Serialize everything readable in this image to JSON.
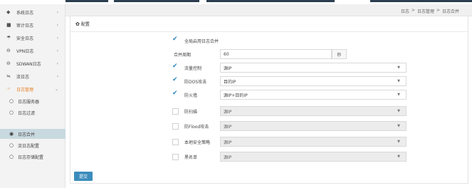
{
  "breadcrumb": [
    "日志",
    ">",
    "日志管理",
    ">",
    "日志合并"
  ],
  "sidebar": {
    "items": [
      {
        "icon": "tag-icon",
        "glyph": "◆",
        "label": "系统日志",
        "chevron": "‹"
      },
      {
        "icon": "monitor-icon",
        "glyph": "■",
        "label": "审计日志",
        "chevron": "‹"
      },
      {
        "icon": "umbrella-icon",
        "glyph": "☂",
        "label": "安全日志",
        "chevron": "‹"
      },
      {
        "icon": "globe-icon",
        "glyph": "⊖",
        "label": "VPN日志",
        "chevron": "‹"
      },
      {
        "icon": "globe-icon",
        "glyph": "⊖",
        "label": "SDWAN日志",
        "chevron": "‹"
      },
      {
        "icon": "flow-icon",
        "glyph": "≒",
        "label": "流日志",
        "chevron": "‹"
      },
      {
        "icon": "hand-icon",
        "glyph": "☞",
        "label": "日志管理",
        "chevron": "⌄"
      }
    ],
    "sub_items": [
      {
        "glyph": "○",
        "label": "日志服务器"
      },
      {
        "glyph": "○",
        "label": "日志过滤"
      },
      {
        "glyph": "◉",
        "label": "日志合并"
      },
      {
        "glyph": "○",
        "label": "流日志配置"
      },
      {
        "glyph": "○",
        "label": "日志存储配置"
      }
    ]
  },
  "panel": {
    "title": "配置",
    "gear_glyph": "✿",
    "global_enable_label": "全局启用日志合并",
    "merge_period_label": "合并周期",
    "merge_period_value": "60",
    "merge_period_unit": "秒",
    "rows": [
      {
        "checked": true,
        "label": "流量控制",
        "value": "源IP",
        "disabled": false
      },
      {
        "checked": true,
        "label": "防DOS攻击",
        "value": "目的IP",
        "disabled": false
      },
      {
        "checked": true,
        "label": "防火墙",
        "value": "源IP+目的IP",
        "disabled": false
      },
      {
        "checked": false,
        "label": "防扫描",
        "value": "源IP",
        "disabled": true
      },
      {
        "checked": false,
        "label": "防Flood攻击",
        "value": "源IP",
        "disabled": true
      },
      {
        "checked": false,
        "label": "本地安全策略",
        "value": "源IP",
        "disabled": true
      },
      {
        "checked": false,
        "label": "黑名单",
        "value": "源IP",
        "disabled": true
      }
    ],
    "submit_label": "提交"
  }
}
